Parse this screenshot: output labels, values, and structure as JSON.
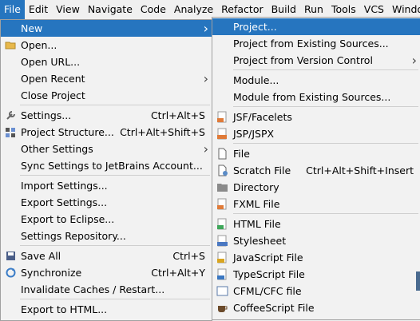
{
  "menubar": [
    "File",
    "Edit",
    "View",
    "Navigate",
    "Code",
    "Analyze",
    "Refactor",
    "Build",
    "Run",
    "Tools",
    "VCS",
    "Windo"
  ],
  "file_menu": [
    {
      "label": "New",
      "shortcut": "",
      "submenu": true,
      "highlight": true
    },
    {
      "label": "Open...",
      "shortcut": "",
      "submenu": false
    },
    {
      "label": "Open URL...",
      "shortcut": "",
      "submenu": false
    },
    {
      "label": "Open Recent",
      "shortcut": "",
      "submenu": true
    },
    {
      "label": "Close Project",
      "shortcut": "",
      "submenu": false
    },
    {
      "label": "Settings...",
      "shortcut": "Ctrl+Alt+S",
      "submenu": false
    },
    {
      "label": "Project Structure...",
      "shortcut": "Ctrl+Alt+Shift+S",
      "submenu": false
    },
    {
      "label": "Other Settings",
      "shortcut": "",
      "submenu": true
    },
    {
      "label": "Sync Settings to JetBrains Account...",
      "shortcut": "",
      "submenu": false
    },
    {
      "label": "Import Settings...",
      "shortcut": "",
      "submenu": false
    },
    {
      "label": "Export Settings...",
      "shortcut": "",
      "submenu": false
    },
    {
      "label": "Export to Eclipse...",
      "shortcut": "",
      "submenu": false
    },
    {
      "label": "Settings Repository...",
      "shortcut": "",
      "submenu": false
    },
    {
      "label": "Save All",
      "shortcut": "Ctrl+S",
      "submenu": false
    },
    {
      "label": "Synchronize",
      "shortcut": "Ctrl+Alt+Y",
      "submenu": false
    },
    {
      "label": "Invalidate Caches / Restart...",
      "shortcut": "",
      "submenu": false
    },
    {
      "label": "Export to HTML...",
      "shortcut": "",
      "submenu": false
    }
  ],
  "new_menu": [
    {
      "label": "Project...",
      "shortcut": "",
      "submenu": false,
      "highlight": true
    },
    {
      "label": "Project from Existing Sources...",
      "shortcut": "",
      "submenu": false
    },
    {
      "label": "Project from Version Control",
      "shortcut": "",
      "submenu": true
    },
    {
      "label": "Module...",
      "shortcut": "",
      "submenu": false
    },
    {
      "label": "Module from Existing Sources...",
      "shortcut": "",
      "submenu": false
    },
    {
      "label": "JSF/Facelets",
      "shortcut": "",
      "submenu": false
    },
    {
      "label": "JSP/JSPX",
      "shortcut": "",
      "submenu": false
    },
    {
      "label": "File",
      "shortcut": "",
      "submenu": false
    },
    {
      "label": "Scratch File",
      "shortcut": "Ctrl+Alt+Shift+Insert",
      "submenu": false
    },
    {
      "label": "Directory",
      "shortcut": "",
      "submenu": false
    },
    {
      "label": "FXML File",
      "shortcut": "",
      "submenu": false
    },
    {
      "label": "HTML File",
      "shortcut": "",
      "submenu": false
    },
    {
      "label": "Stylesheet",
      "shortcut": "",
      "submenu": false
    },
    {
      "label": "JavaScript File",
      "shortcut": "",
      "submenu": false
    },
    {
      "label": "TypeScript File",
      "shortcut": "",
      "submenu": false
    },
    {
      "label": "CFML/CFC file",
      "shortcut": "",
      "submenu": false
    },
    {
      "label": "CoffeeScript File",
      "shortcut": "",
      "submenu": false
    }
  ],
  "icons": {
    "file_menu": {
      "1": "folder-open-icon",
      "5": "wrench-icon",
      "6": "project-structure-icon",
      "13": "save-icon",
      "14": "sync-icon"
    },
    "new_menu": {
      "5": "jsf-icon",
      "6": "jsp-icon",
      "7": "file-icon",
      "8": "scratch-file-icon",
      "9": "folder-icon",
      "10": "fxml-icon",
      "11": "html-icon",
      "12": "css-icon",
      "13": "js-icon",
      "14": "ts-icon",
      "15": "cfml-icon",
      "16": "coffeescript-icon"
    }
  },
  "colors": {
    "highlight": "#2675bf",
    "menu_bg": "#f2f2f2",
    "menubar_bg": "#f0f0f0"
  }
}
